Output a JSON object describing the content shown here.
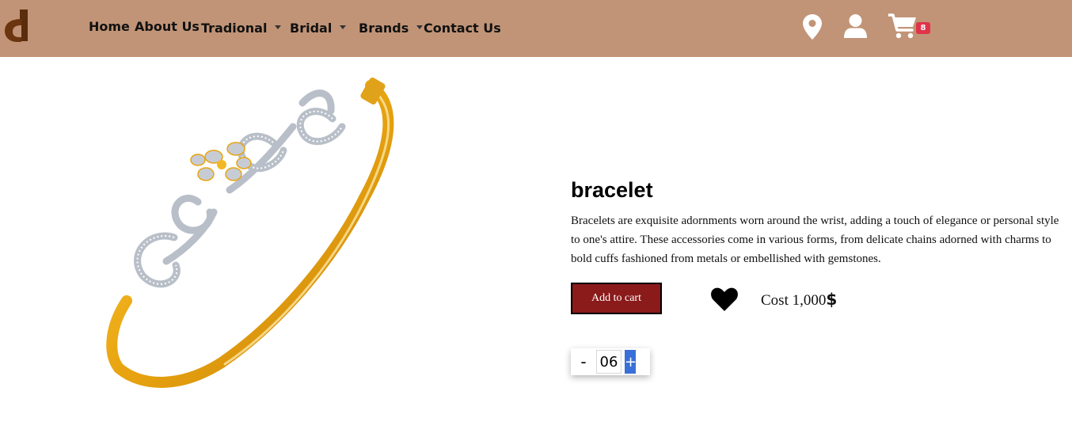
{
  "brand": {
    "logo_icon": "d-logo-icon",
    "color": "#5a2e0c"
  },
  "nav": {
    "home": "Home",
    "about": "About Us",
    "traditional": "Tradional",
    "bridal": "Bridal",
    "brands": "Brands",
    "contact": "Contact Us"
  },
  "header_icons": {
    "location": "location-pin-icon",
    "account": "user-icon",
    "cart": "cart-icon",
    "cart_count": "8"
  },
  "product": {
    "title": "bracelet",
    "description": "Bracelets are exquisite adornments worn around the wrist, adding a touch of elegance or personal style to one's attire. These accessories come in various forms, from delicate chains adorned with charms to bold cuffs fashioned from metals or embellished with gemstones.",
    "add_to_cart_label": "Add to cart",
    "favorite_icon": "heart-icon",
    "cost_label": "Cost",
    "cost_value": "1,000",
    "currency_symbol": "$",
    "quantity": "06",
    "minus_label": "-",
    "plus_label": "+"
  },
  "colors": {
    "navbar": "#c19477",
    "add_to_cart_button": "#8b1a1a",
    "plus_button": "#3a6fd8",
    "badge": "#e0344a"
  }
}
